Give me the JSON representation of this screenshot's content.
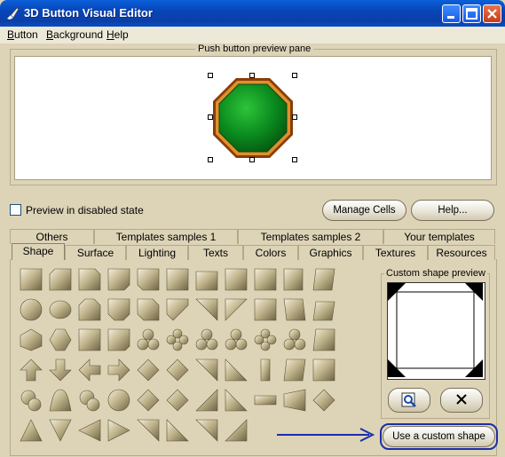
{
  "window": {
    "title": "3D Button Visual Editor"
  },
  "menubar": {
    "items": [
      {
        "label": "Button",
        "accel": "B"
      },
      {
        "label": "Background",
        "accel": "B"
      },
      {
        "label": "Help",
        "accel": "H"
      }
    ]
  },
  "preview": {
    "group_label": "Push button preview pane"
  },
  "options": {
    "disabled_label": "Preview in disabled state",
    "disabled_checked": false
  },
  "buttons": {
    "manage_cells": "Manage Cells",
    "help": "Help...",
    "use_custom": "Use a custom shape"
  },
  "tabs": {
    "row1": [
      "Others",
      "Templates samples 1",
      "Templates samples 2",
      "Your templates"
    ],
    "row2": [
      "Shape",
      "Surface",
      "Lighting",
      "Texts",
      "Colors",
      "Graphics",
      "Textures",
      "Resources"
    ],
    "active": "Shape"
  },
  "custom_shape": {
    "group_label": "Custom shape preview"
  },
  "icons": {
    "app": "paintbrush-icon",
    "browse": "browse-folder-icon",
    "delete": "close-x-icon"
  },
  "colors": {
    "button_green": "#0a8a1e",
    "button_border": "#a8500c",
    "titlebar": "#0a4fc4",
    "callout": "#1c2ea8"
  }
}
